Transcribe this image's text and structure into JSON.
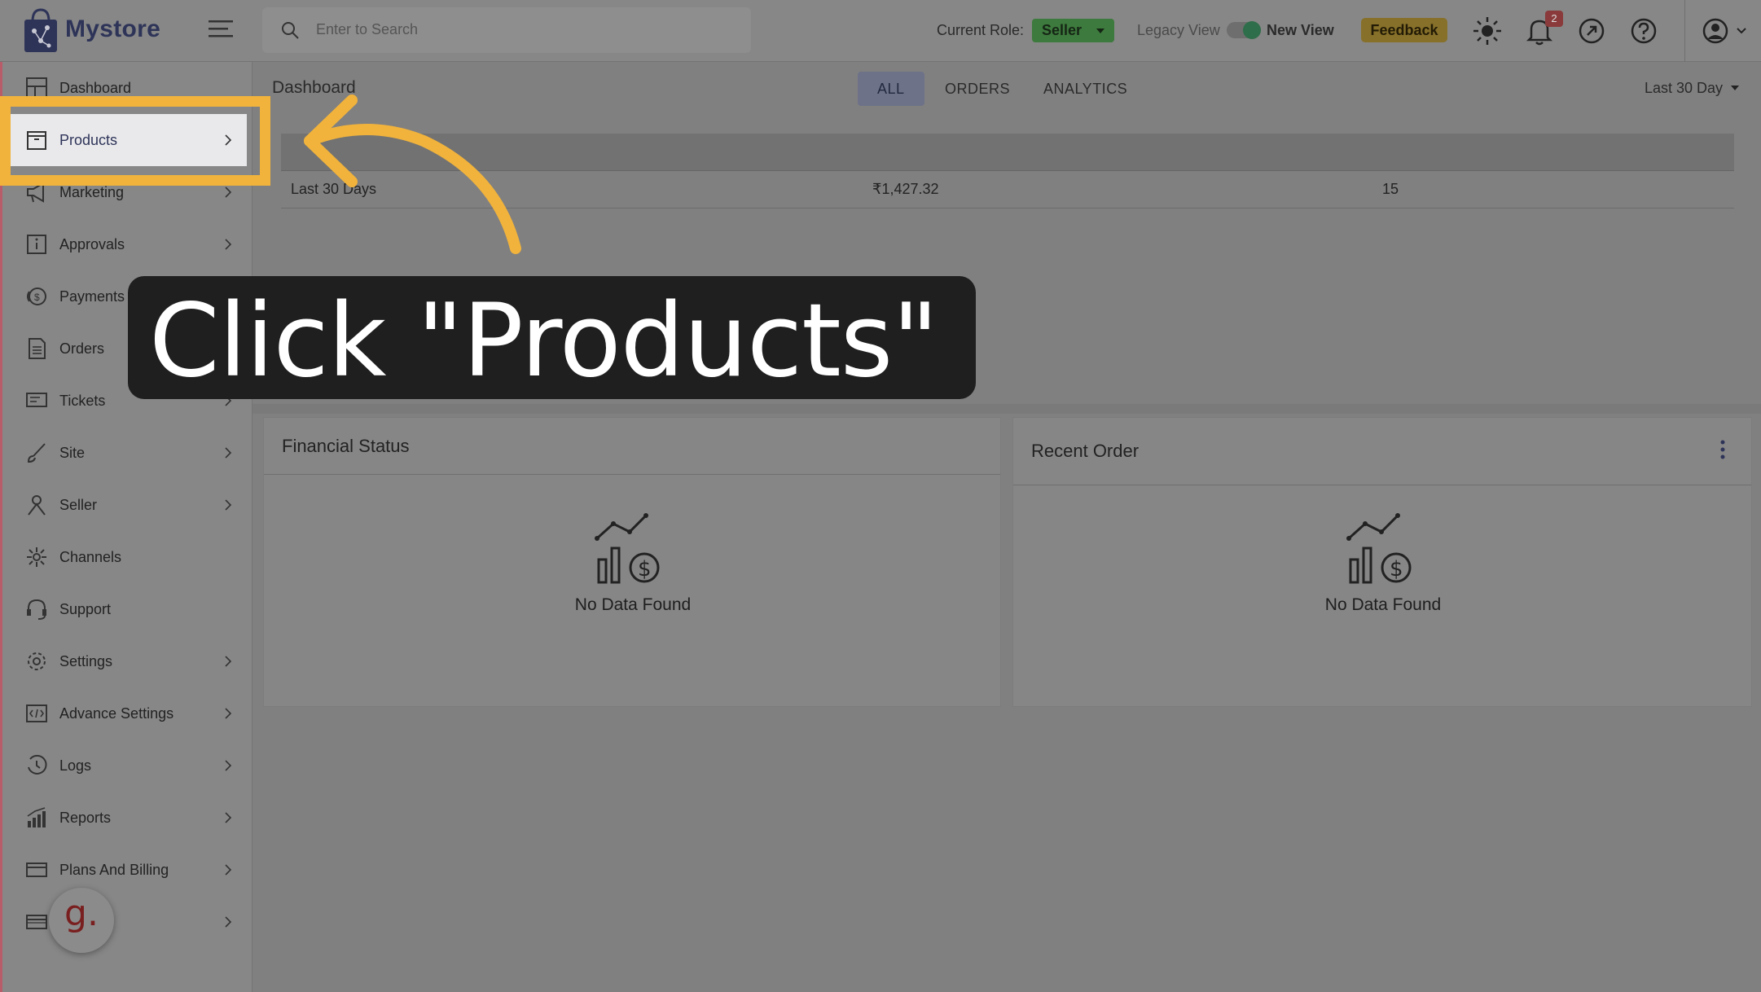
{
  "app": {
    "brand": "Mystore"
  },
  "header": {
    "search_placeholder": "Enter to Search",
    "role_label": "Current Role:",
    "role_value": "Seller",
    "legacy_view": "Legacy View",
    "new_view": "New View",
    "feedback": "Feedback",
    "notification_count": "2"
  },
  "sidebar": {
    "items": [
      {
        "label": "Dashboard",
        "icon": "dashboard-icon",
        "chevron": false
      },
      {
        "label": "Products",
        "icon": "products-icon",
        "chevron": true,
        "active": true
      },
      {
        "label": "Marketing",
        "icon": "megaphone-icon",
        "chevron": true
      },
      {
        "label": "Approvals",
        "icon": "approvals-icon",
        "chevron": true
      },
      {
        "label": "Payments",
        "icon": "payments-icon",
        "chevron": true
      },
      {
        "label": "Orders",
        "icon": "orders-icon",
        "chevron": true
      },
      {
        "label": "Tickets",
        "icon": "tickets-icon",
        "chevron": true
      },
      {
        "label": "Site",
        "icon": "brush-icon",
        "chevron": true
      },
      {
        "label": "Seller",
        "icon": "seller-icon",
        "chevron": true
      },
      {
        "label": "Channels",
        "icon": "channels-icon",
        "chevron": false
      },
      {
        "label": "Support",
        "icon": "headset-icon",
        "chevron": false
      },
      {
        "label": "Settings",
        "icon": "gear-icon",
        "chevron": true
      },
      {
        "label": "Advance Settings",
        "icon": "code-icon",
        "chevron": true
      },
      {
        "label": "Logs",
        "icon": "logs-icon",
        "chevron": true
      },
      {
        "label": "Reports",
        "icon": "reports-icon",
        "chevron": true
      },
      {
        "label": "Plans And Billing",
        "icon": "billing-icon",
        "chevron": true
      },
      {
        "label": "",
        "icon": "card-icon",
        "chevron": true
      }
    ]
  },
  "main": {
    "page_title": "Dashboard",
    "tabs": [
      "ALL",
      "ORDERS",
      "ANALYTICS"
    ],
    "active_tab": "ALL",
    "date_range": "Last 30 Day",
    "summary": {
      "period": "Last 30 Days",
      "amount": "₹1,427.32",
      "count": "15"
    }
  },
  "cards": {
    "financial": {
      "title": "Financial Status",
      "empty": "No Data Found"
    },
    "recent": {
      "title": "Recent Order",
      "empty": "No Data Found"
    }
  },
  "tooltip": {
    "text": "Click \"Products\""
  },
  "bubble": {
    "letter": "g."
  },
  "colors": {
    "highlight": "#f1b33c",
    "role_badge": "#3d7a3d",
    "feedback": "#86702a"
  }
}
